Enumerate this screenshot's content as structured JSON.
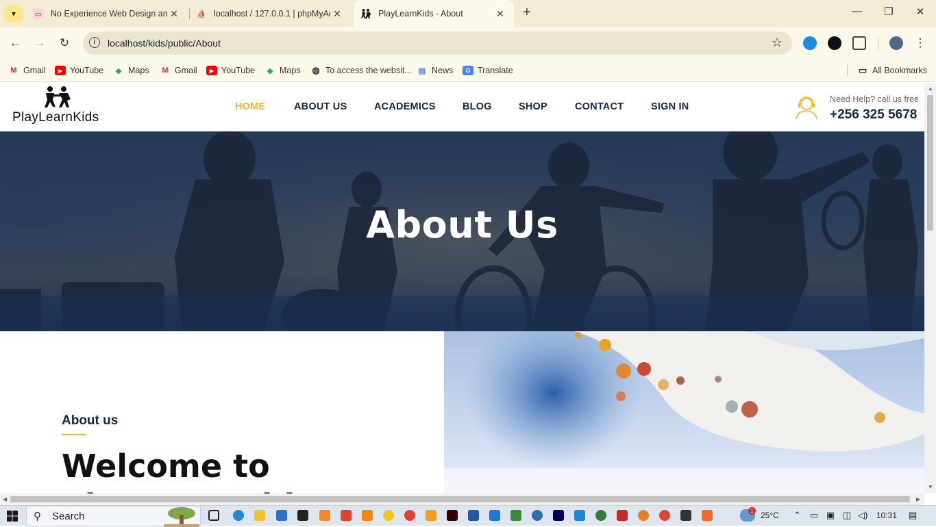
{
  "browser": {
    "tabs": [
      {
        "title": "No Experience Web Design and",
        "active": false
      },
      {
        "title": "localhost / 127.0.0.1 | phpMyAd",
        "active": false
      },
      {
        "title": "PlayLearnKids - About",
        "active": true
      }
    ],
    "address": "localhost/kids/public/About",
    "bookmarks": [
      {
        "label": "Gmail",
        "icon": "gmail-icon"
      },
      {
        "label": "YouTube",
        "icon": "youtube-icon"
      },
      {
        "label": "Maps",
        "icon": "maps-icon"
      },
      {
        "label": "Gmail",
        "icon": "gmail-icon"
      },
      {
        "label": "YouTube",
        "icon": "youtube-icon"
      },
      {
        "label": "Maps",
        "icon": "maps-icon"
      },
      {
        "label": "To access the websit...",
        "icon": "globe-icon"
      },
      {
        "label": "News",
        "icon": "news-icon"
      },
      {
        "label": "Translate",
        "icon": "translate-icon"
      }
    ],
    "all_bookmarks": "All Bookmarks"
  },
  "site": {
    "logo_text": "PlayLearnKids",
    "nav": [
      "HOME",
      "ABOUT US",
      "ACADEMICS",
      "BLOG",
      "SHOP",
      "CONTACT",
      "SIGN IN"
    ],
    "active_nav": "HOME",
    "help_text": "Need Help? call us free",
    "phone": "+256 325 5678",
    "hero_title": "About Us",
    "about_label": "About us",
    "welcome_heading": "Welcome to",
    "welcome_heading_cont": "PlayLearnKids"
  },
  "taskbar": {
    "search_placeholder": "Search",
    "weather": "25°C",
    "time": "10:31",
    "notification_badge": "1"
  },
  "colors": {
    "accent": "#f0b429",
    "navy": "#0f2a4a",
    "chrome_frame": "#f2ecd5"
  }
}
